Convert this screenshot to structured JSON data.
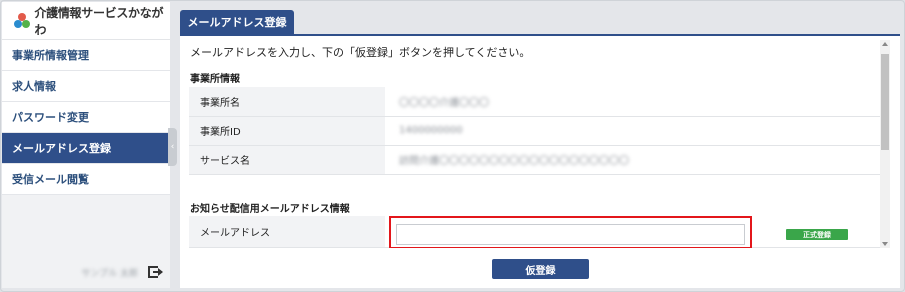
{
  "app": {
    "logo_text": "介護情報サービスかながわ"
  },
  "sidebar": {
    "items": [
      {
        "label": "事業所情報管理",
        "active": false
      },
      {
        "label": "求人情報",
        "active": false
      },
      {
        "label": "パスワード変更",
        "active": false
      },
      {
        "label": "メールアドレス登録",
        "active": true
      },
      {
        "label": "受信メール閲覧",
        "active": false
      }
    ],
    "user_name": "サンプル 太郎",
    "logout_icon": "logout-icon"
  },
  "main": {
    "tab_label": "メールアドレス登録",
    "instruction": "メールアドレスを入力し、下の「仮登録」ボタンを押してください。",
    "office_section": {
      "title": "事業所情報",
      "rows": [
        {
          "label": "事業所名",
          "value": "〇〇〇〇介護〇〇〇"
        },
        {
          "label": "事業所ID",
          "value": "1400000000"
        },
        {
          "label": "サービス名",
          "value": "訪問介護〇〇〇〇〇〇〇〇〇〇〇〇〇〇〇〇〇〇〇"
        }
      ]
    },
    "email_section": {
      "title": "お知らせ配信用メールアドレス情報",
      "label": "メールアドレス",
      "input_value": "",
      "input_placeholder": "",
      "status_badge": "正式登録"
    },
    "submit_label": "仮登録"
  },
  "colors": {
    "accent": "#2f4f8a",
    "highlight_border": "#e3161b",
    "badge_green": "#3aa64a"
  }
}
